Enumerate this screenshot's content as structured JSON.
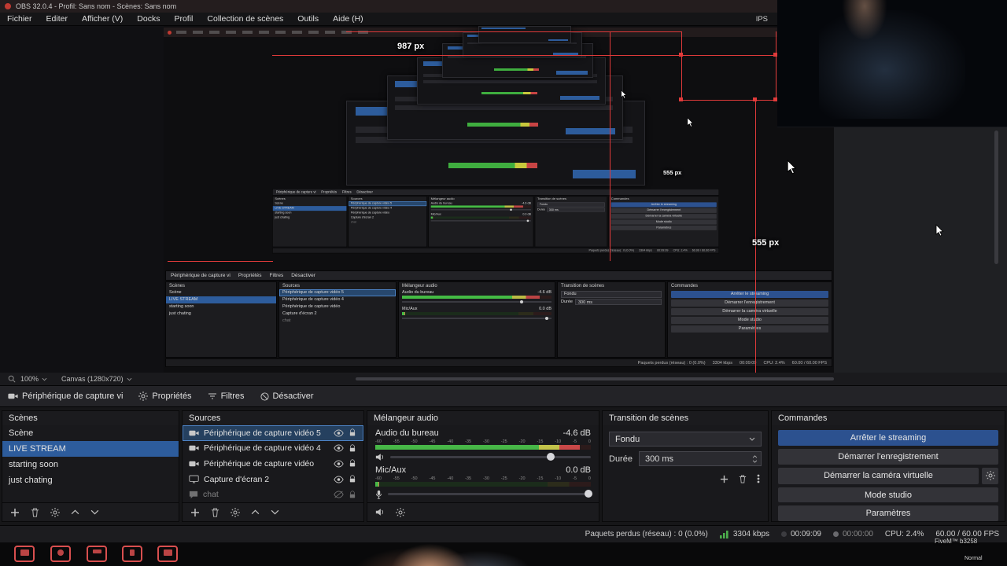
{
  "window": {
    "title": "OBS 32.0.4 - Profil: Sans nom - Scènes: Sans nom",
    "menu": [
      "Fichier",
      "Editer",
      "Afficher (V)",
      "Docks",
      "Profil",
      "Collection de scènes",
      "Outils",
      "Aide (H)"
    ],
    "menu_right": "IPS"
  },
  "preview": {
    "width_label": "987 px",
    "height_label": "555 px",
    "height_label_small": "555 px",
    "zoom": "100%",
    "canvas": "Canvas (1280x720)"
  },
  "source_toolbar": {
    "source_name": "Périphérique de capture vi",
    "properties": "Propriétés",
    "filters": "Filtres",
    "disable": "Désactiver"
  },
  "scenes": {
    "title": "Scènes",
    "items": [
      {
        "label": "Scène"
      },
      {
        "label": "LIVE STREAM"
      },
      {
        "label": "starting soon"
      },
      {
        "label": "just chating"
      }
    ]
  },
  "sources": {
    "title": "Sources",
    "items": [
      {
        "label": "Périphérique de capture vidéo 5",
        "icon": "camera-icon"
      },
      {
        "label": "Périphérique de capture vidéo 4",
        "icon": "camera-icon"
      },
      {
        "label": "Périphérique de capture vidéo",
        "icon": "camera-icon"
      },
      {
        "label": "Capture d'écran 2",
        "icon": "display-icon"
      },
      {
        "label": "chat",
        "icon": "chat-icon"
      }
    ]
  },
  "mixer": {
    "title": "Mélangeur audio",
    "ticks": [
      "-60",
      "-55",
      "-50",
      "-45",
      "-40",
      "-35",
      "-30",
      "-25",
      "-20",
      "-15",
      "-10",
      "-5",
      "0"
    ],
    "channels": [
      {
        "name": "Audio du bureau",
        "db": "-4.6 dB"
      },
      {
        "name": "Mic/Aux",
        "db": "0.0 dB"
      }
    ]
  },
  "transition": {
    "title": "Transition de scènes",
    "selected": "Fondu",
    "duration_label": "Durée",
    "duration_value": "300 ms"
  },
  "controls": {
    "title": "Commandes",
    "stop_streaming": "Arrêter le streaming",
    "start_recording": "Démarrer l'enregistrement",
    "start_virtual_cam": "Démarrer la caméra virtuelle",
    "studio_mode": "Mode studio",
    "settings": "Paramètres"
  },
  "statusbar": {
    "dropped_frames": "Paquets perdus (réseau) : 0 (0.0%)",
    "bitrate": "3304 kbps",
    "stream_time": "00:09:09",
    "rec_time": "00:00:00",
    "cpu": "CPU: 2.4%",
    "fps": "60.00 / 60.00 FPS"
  },
  "watermark": {
    "line1": "FiveM™ b3258",
    "line2": "Normal"
  },
  "colors": {
    "accent_blue": "#2d5c9c",
    "selection_red": "#e03a3a",
    "meter_green": "#47b747"
  }
}
